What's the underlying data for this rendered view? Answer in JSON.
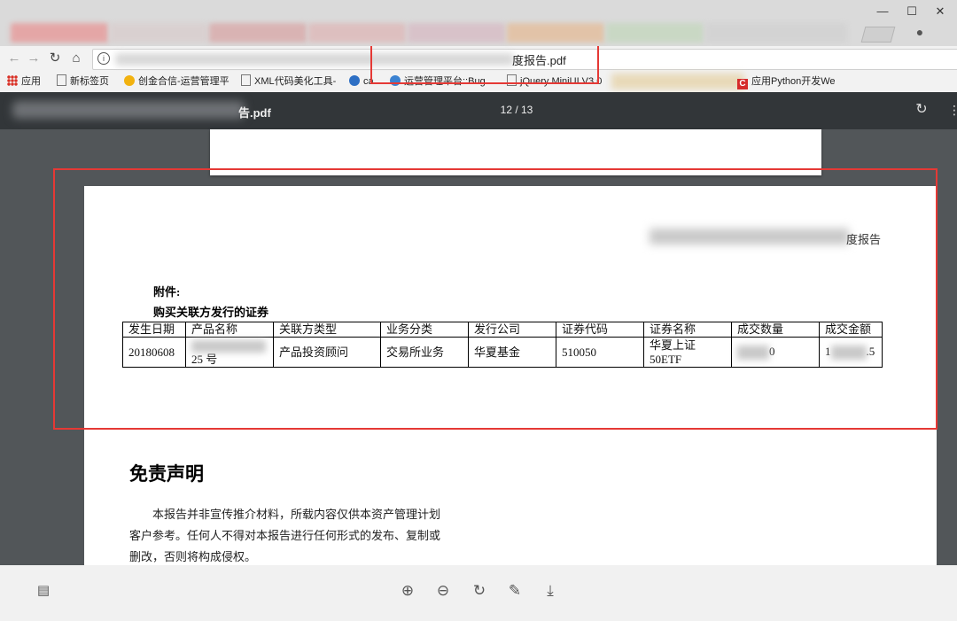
{
  "browser": {
    "window_controls": {
      "minimize": "—",
      "maximize": "☐",
      "close": "✕"
    },
    "nav": {
      "back_icon": "←",
      "forward_icon": "→",
      "reload_icon": "↻",
      "home_icon": "⌂"
    },
    "address": {
      "url_visible": "度报告.pdf"
    },
    "bookmarks": [
      {
        "label": "应用",
        "icon": "apps-grid-icon"
      },
      {
        "label": "新标签页",
        "icon": "page-icon"
      },
      {
        "label": "创金合信-运营管理平",
        "icon": "coin-icon"
      },
      {
        "label": "XML代码美化工具-",
        "icon": "page-icon"
      },
      {
        "label": "ca",
        "icon": "blue-globe-icon"
      },
      {
        "label": "运营管理平台::Bug",
        "icon": "blue-globe-icon"
      },
      {
        "label": "jQuery MiniUI V3.0",
        "icon": "page-icon"
      },
      {
        "label": "应用Python开发We",
        "icon": "red-c-icon"
      }
    ]
  },
  "viewer": {
    "title_suffix": "告.pdf",
    "page_indicator": "12 / 13"
  },
  "document": {
    "header_right": "度报告",
    "attachment_label": "附件:",
    "attachment_subtitle": "购买关联方发行的证券",
    "table": {
      "headers": [
        "发生日期",
        "产品名称",
        "关联方类型",
        "业务分类",
        "发行公司",
        "证券代码",
        "证券名称",
        "成交数量",
        "成交金额"
      ],
      "row": {
        "date": "20180608",
        "product_suffix": "25 号",
        "related_type": "产品投资顾问",
        "business": "交易所业务",
        "issuer": "华夏基金",
        "code": "510050",
        "name_line1": "华夏上证",
        "name_line2": "50ETF",
        "qty_suffix": "0",
        "amount_prefix": "1",
        "amount_suffix": ".5"
      }
    },
    "disclaimer_title": "免责声明",
    "disclaimer_lines": [
      "本报告并非宣传推介材料，所载内容仅供本资产管理计划",
      "客户参考。任何人不得对本报告进行任何形式的发布、复制或",
      "删改，否则将构成侵权。"
    ]
  },
  "colors": {
    "highlight": "#e53935",
    "viewer_bg": "#525659",
    "viewer_header": "#323639"
  }
}
